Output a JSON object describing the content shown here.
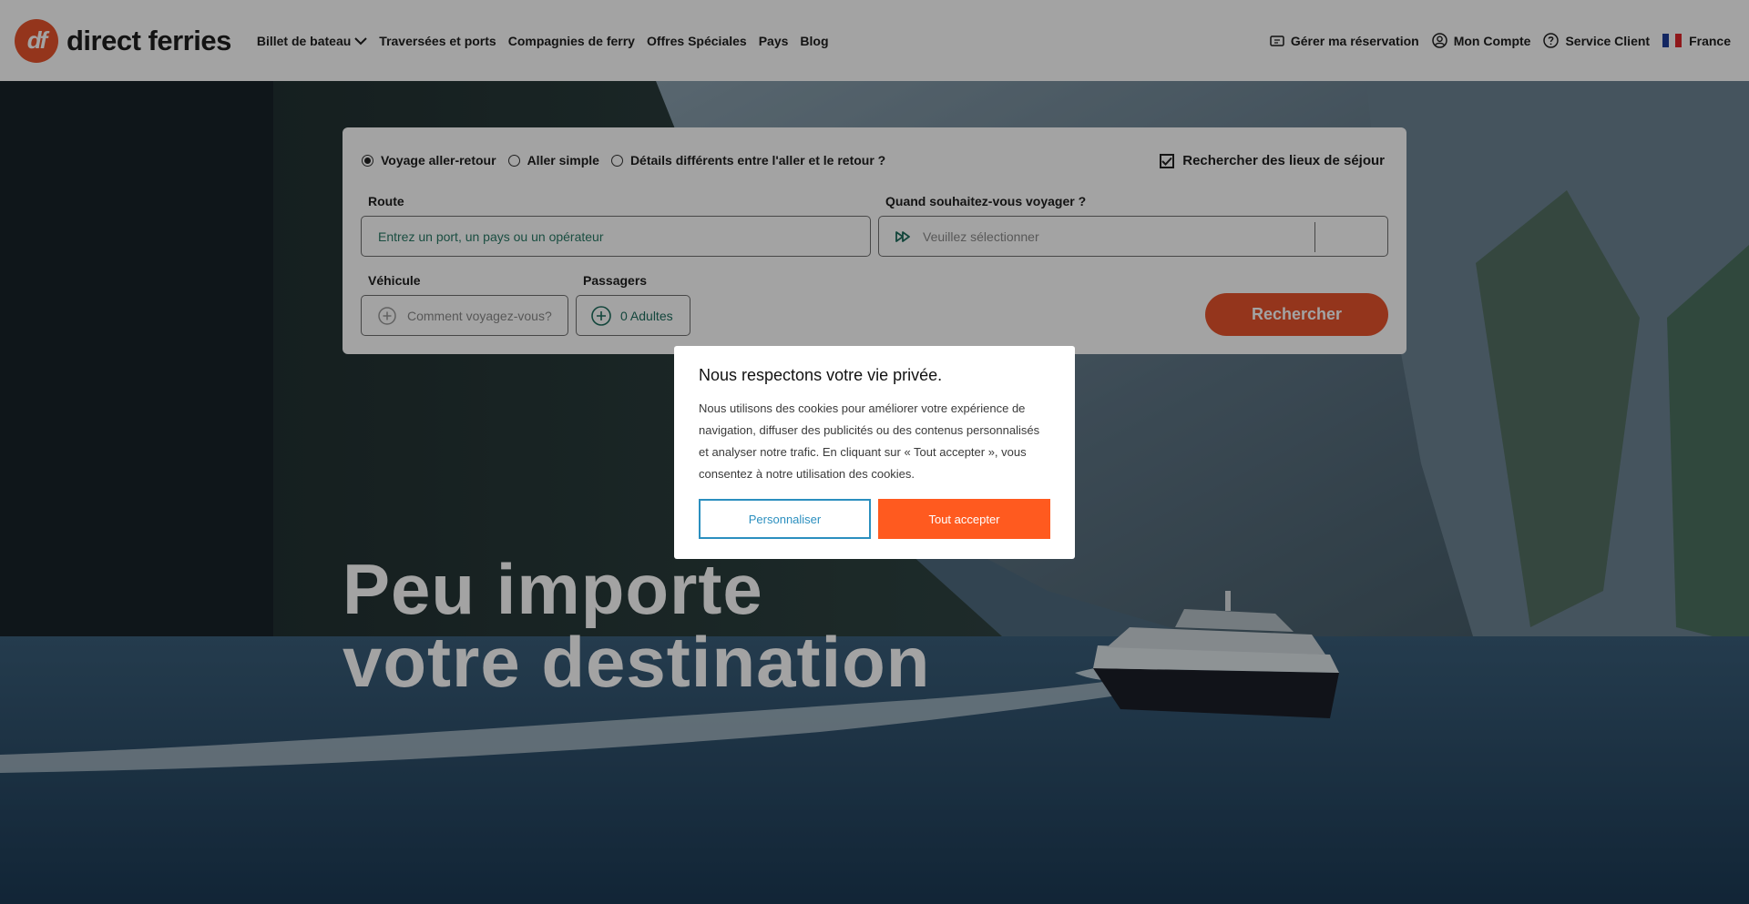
{
  "header": {
    "logo_badge": "df",
    "logo_text": "direct ferries",
    "nav": [
      {
        "label": "Billet de bateau"
      },
      {
        "label": "Traversées et ports"
      },
      {
        "label": "Compagnies de ferry"
      },
      {
        "label": "Offres Spéciales"
      },
      {
        "label": "Pays"
      },
      {
        "label": "Blog"
      }
    ],
    "right": {
      "manage": "Gérer ma réservation",
      "account": "Mon Compte",
      "service": "Service Client",
      "country": "France"
    }
  },
  "search": {
    "trip_types": [
      "Voyage aller-retour",
      "Aller simple",
      "Détails différents entre l'aller et le retour ?"
    ],
    "selected_trip": 0,
    "stays_label": "Rechercher des lieux de séjour",
    "route_label": "Route",
    "route_placeholder": "Entrez un port, un pays ou un opérateur",
    "date_label": "Quand souhaitez-vous voyager ?",
    "date_placeholder": "Veuillez sélectionner",
    "vehicle_label": "Véhicule",
    "vehicle_placeholder": "Comment voyagez-vous?",
    "passengers_label": "Passagers",
    "passengers_value": "0 Adultes",
    "search_button": "Rechercher"
  },
  "hero": {
    "line1": "Peu importe",
    "line2": "votre destination"
  },
  "cookie": {
    "title": "Nous respectons votre vie privée.",
    "text": "Nous utilisons des cookies pour améliorer votre expérience de navigation, diffuser des publicités ou des contenus personnalisés et analyser notre trafic. En cliquant sur « Tout accepter », vous consentez à notre utilisation des cookies.",
    "customize": "Personnaliser",
    "accept": "Tout accepter"
  },
  "colors": {
    "brand": "#e8542d",
    "accept": "#ff5a1f",
    "customize_border": "#2b8fbf"
  }
}
